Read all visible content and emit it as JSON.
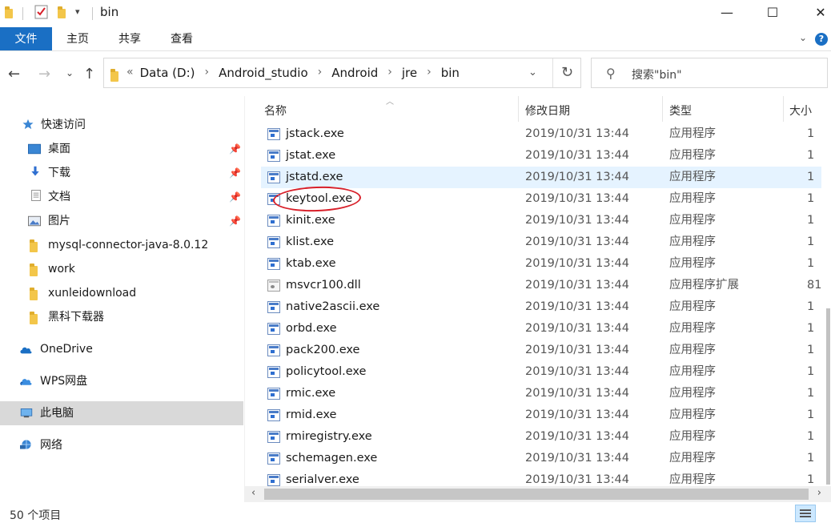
{
  "window": {
    "title": "bin",
    "minimize": "—",
    "maximize": "☐",
    "close": "✕"
  },
  "ribbon": {
    "tabs": [
      "文件",
      "主页",
      "共享",
      "查看"
    ],
    "help": "?"
  },
  "address": {
    "crumbs": [
      "Data (D:)",
      "Android_studio",
      "Android",
      "jre",
      "bin"
    ],
    "prefix": "«",
    "search_placeholder": "搜索\"bin\""
  },
  "sidebar": {
    "items": [
      {
        "label": "快速访问",
        "icon": "star-icon"
      },
      {
        "label": "桌面",
        "icon": "desktop-icon",
        "pinned": true
      },
      {
        "label": "下载",
        "icon": "download-icon",
        "pinned": true
      },
      {
        "label": "文档",
        "icon": "document-icon",
        "pinned": true
      },
      {
        "label": "图片",
        "icon": "picture-icon",
        "pinned": true
      },
      {
        "label": "mysql-connector-java-8.0.12",
        "icon": "folder-icon"
      },
      {
        "label": "work",
        "icon": "folder-icon"
      },
      {
        "label": "xunleidownload",
        "icon": "folder-icon"
      },
      {
        "label": "黑科下载器",
        "icon": "folder-icon"
      },
      {
        "label": "OneDrive",
        "icon": "cloud-icon"
      },
      {
        "label": "WPS网盘",
        "icon": "cloud-icon"
      },
      {
        "label": "此电脑",
        "icon": "computer-icon",
        "selected": true
      },
      {
        "label": "网络",
        "icon": "network-icon"
      }
    ]
  },
  "columns": {
    "name": "名称",
    "date": "修改日期",
    "type": "类型",
    "size": "大小"
  },
  "files": [
    {
      "name": "jstack.exe",
      "date": "2019/10/31 13:44",
      "type": "应用程序",
      "size": "1"
    },
    {
      "name": "jstat.exe",
      "date": "2019/10/31 13:44",
      "type": "应用程序",
      "size": "1"
    },
    {
      "name": "jstatd.exe",
      "date": "2019/10/31 13:44",
      "type": "应用程序",
      "size": "1"
    },
    {
      "name": "keytool.exe",
      "date": "2019/10/31 13:44",
      "type": "应用程序",
      "size": "1"
    },
    {
      "name": "kinit.exe",
      "date": "2019/10/31 13:44",
      "type": "应用程序",
      "size": "1"
    },
    {
      "name": "klist.exe",
      "date": "2019/10/31 13:44",
      "type": "应用程序",
      "size": "1"
    },
    {
      "name": "ktab.exe",
      "date": "2019/10/31 13:44",
      "type": "应用程序",
      "size": "1"
    },
    {
      "name": "msvcr100.dll",
      "date": "2019/10/31 13:44",
      "type": "应用程序扩展",
      "size": "81"
    },
    {
      "name": "native2ascii.exe",
      "date": "2019/10/31 13:44",
      "type": "应用程序",
      "size": "1"
    },
    {
      "name": "orbd.exe",
      "date": "2019/10/31 13:44",
      "type": "应用程序",
      "size": "1"
    },
    {
      "name": "pack200.exe",
      "date": "2019/10/31 13:44",
      "type": "应用程序",
      "size": "1"
    },
    {
      "name": "policytool.exe",
      "date": "2019/10/31 13:44",
      "type": "应用程序",
      "size": "1"
    },
    {
      "name": "rmic.exe",
      "date": "2019/10/31 13:44",
      "type": "应用程序",
      "size": "1"
    },
    {
      "name": "rmid.exe",
      "date": "2019/10/31 13:44",
      "type": "应用程序",
      "size": "1"
    },
    {
      "name": "rmiregistry.exe",
      "date": "2019/10/31 13:44",
      "type": "应用程序",
      "size": "1"
    },
    {
      "name": "schemagen.exe",
      "date": "2019/10/31 13:44",
      "type": "应用程序",
      "size": "1"
    },
    {
      "name": "serialver.exe",
      "date": "2019/10/31 13:44",
      "type": "应用程序",
      "size": "1"
    }
  ],
  "status": {
    "count": "50 个项目"
  },
  "colors": {
    "accent": "#1a6fc4",
    "hover_row": "#e5f3ff",
    "annotation": "#d8202a"
  }
}
